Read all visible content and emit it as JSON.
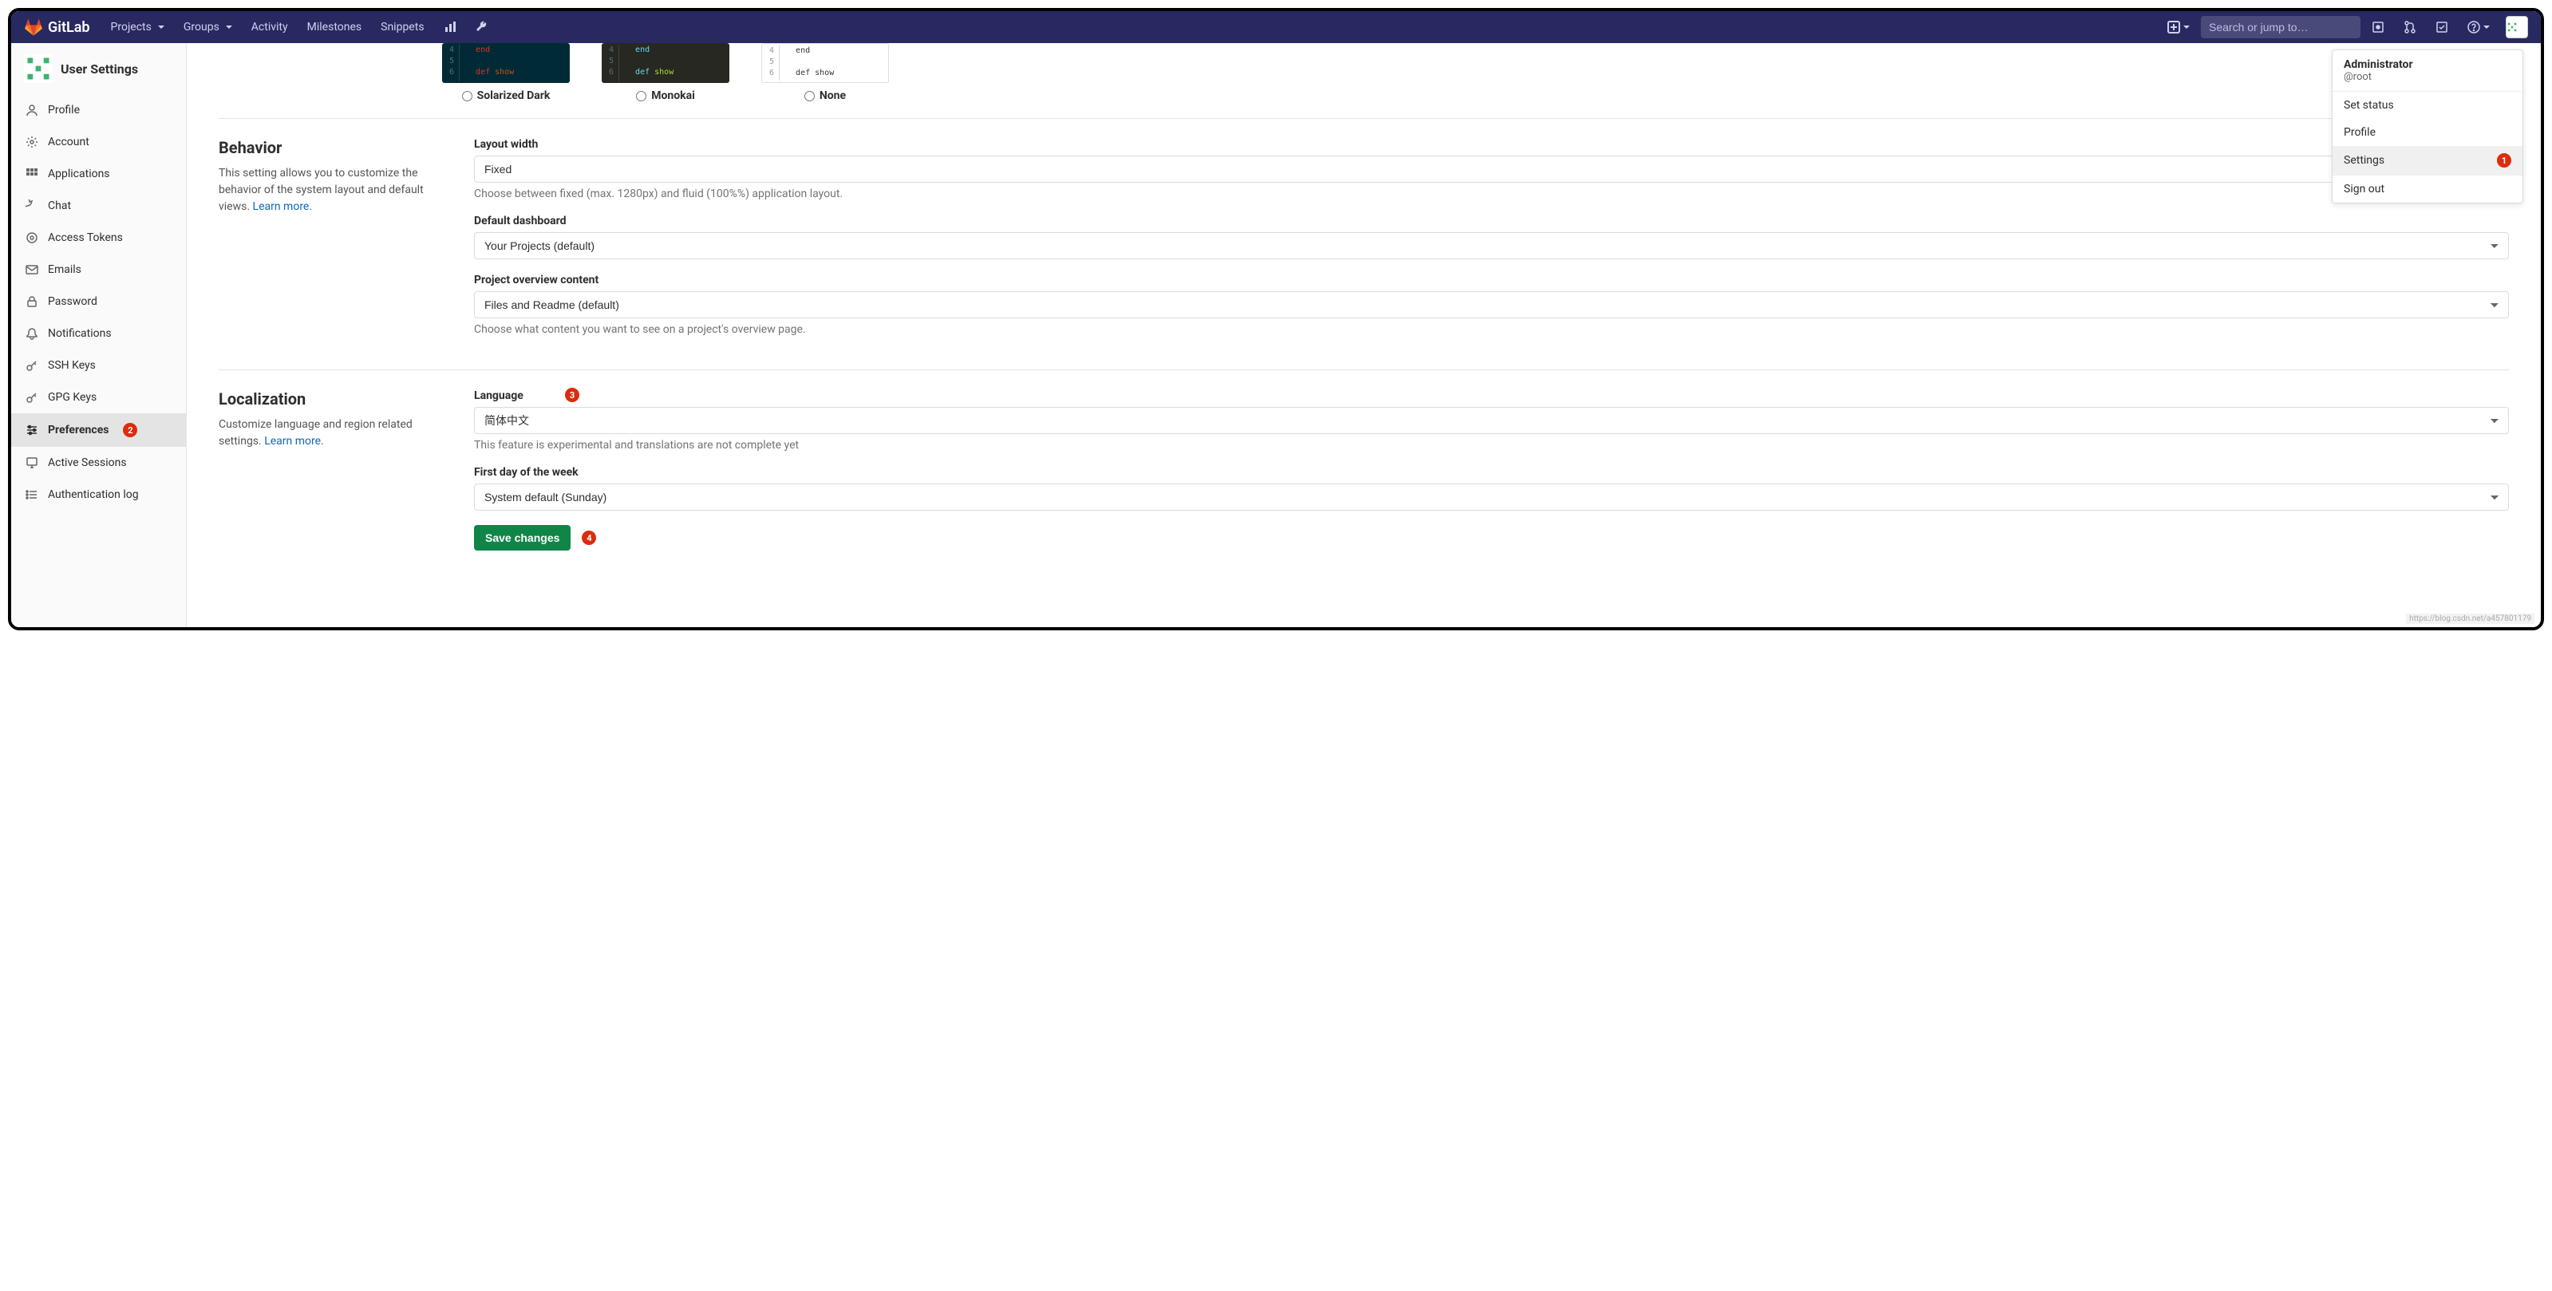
{
  "brand": "GitLab",
  "nav": {
    "projects": "Projects",
    "groups": "Groups",
    "activity": "Activity",
    "milestones": "Milestones",
    "snippets": "Snippets",
    "search_placeholder": "Search or jump to…"
  },
  "sidebar": {
    "title": "User Settings",
    "items": [
      {
        "label": "Profile"
      },
      {
        "label": "Account"
      },
      {
        "label": "Applications"
      },
      {
        "label": "Chat"
      },
      {
        "label": "Access Tokens"
      },
      {
        "label": "Emails"
      },
      {
        "label": "Password"
      },
      {
        "label": "Notifications"
      },
      {
        "label": "SSH Keys"
      },
      {
        "label": "GPG Keys"
      },
      {
        "label": "Preferences"
      },
      {
        "label": "Active Sessions"
      },
      {
        "label": "Authentication log"
      }
    ],
    "annotation_preferences": "2"
  },
  "themes": {
    "code_end": "end",
    "code_def": "def",
    "code_show": "show",
    "lines": {
      "l4": "4",
      "l5": "5",
      "l6": "6"
    },
    "opt1": "Solarized Dark",
    "opt2": "Monokai",
    "opt3": "None"
  },
  "behavior": {
    "title": "Behavior",
    "desc": "This setting allows you to customize the behavior of the system layout and default views. ",
    "learn_more": "Learn more",
    "layout_width_label": "Layout width",
    "layout_width_value": "Fixed",
    "layout_width_help": "Choose between fixed (max. 1280px) and fluid (100%%) application layout.",
    "dashboard_label": "Default dashboard",
    "dashboard_value": "Your Projects (default)",
    "overview_label": "Project overview content",
    "overview_value": "Files and Readme (default)",
    "overview_help": "Choose what content you want to see on a project's overview page."
  },
  "localization": {
    "title": "Localization",
    "desc": "Customize language and region related settings. ",
    "learn_more": "Learn more",
    "language_label": "Language",
    "language_value": "简体中文",
    "language_help": "This feature is experimental and translations are not complete yet",
    "language_annotation": "3",
    "first_day_label": "First day of the week",
    "first_day_value": "System default (Sunday)",
    "save_button": "Save changes",
    "save_annotation": "4"
  },
  "dropdown": {
    "name": "Administrator",
    "username": "@root",
    "set_status": "Set status",
    "profile": "Profile",
    "settings": "Settings",
    "settings_annotation": "1",
    "sign_out": "Sign out"
  },
  "watermark": "https://blog.csdn.net/a457801179"
}
